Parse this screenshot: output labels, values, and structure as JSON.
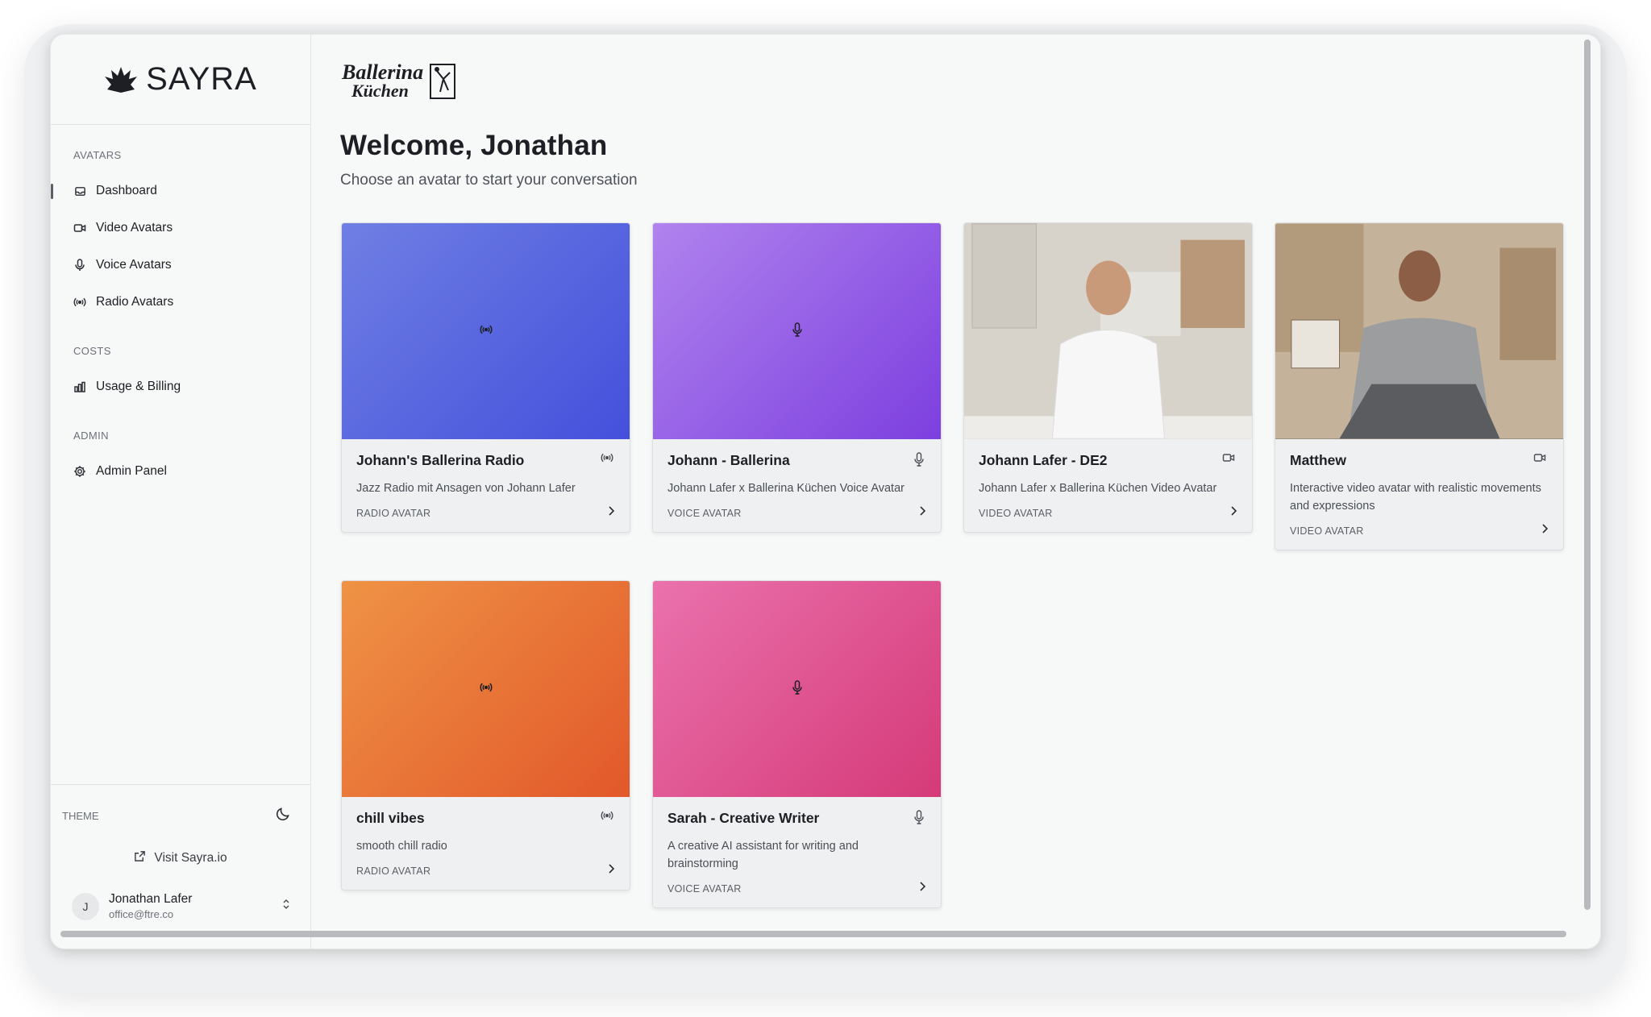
{
  "brand": {
    "name": "SAYRA"
  },
  "sidebar": {
    "sections": [
      {
        "label": "AVATARS",
        "items": [
          {
            "label": "Dashboard",
            "icon": "inbox-icon",
            "active": true
          },
          {
            "label": "Video Avatars",
            "icon": "video-icon"
          },
          {
            "label": "Voice Avatars",
            "icon": "microphone-icon"
          },
          {
            "label": "Radio Avatars",
            "icon": "radio-icon"
          }
        ]
      },
      {
        "label": "COSTS",
        "items": [
          {
            "label": "Usage & Billing",
            "icon": "bar-chart-icon"
          }
        ]
      },
      {
        "label": "ADMIN",
        "items": [
          {
            "label": "Admin Panel",
            "icon": "gear-icon"
          }
        ]
      }
    ],
    "theme_label": "THEME",
    "theme_icon": "moon-icon",
    "visit_label": "Visit Sayra.io",
    "user": {
      "initial": "J",
      "name": "Jonathan Lafer",
      "email": "office@ftre.co"
    }
  },
  "main": {
    "client_logo": {
      "line1": "Ballerina",
      "line2": "Küchen"
    },
    "welcome": "Welcome, Jonathan",
    "subtitle": "Choose an avatar to start your conversation",
    "cards": [
      {
        "title": "Johann's Ballerina Radio",
        "desc": "Jazz Radio mit Ansagen von Johann Lafer",
        "kind": "RADIO AVATAR",
        "icon": "radio-icon",
        "media": "gradient-blue"
      },
      {
        "title": "Johann - Ballerina",
        "desc": "Johann Lafer x Ballerina Küchen Voice Avatar",
        "kind": "VOICE AVATAR",
        "icon": "microphone-icon",
        "media": "gradient-purple"
      },
      {
        "title": "Johann Lafer - DE2",
        "desc": "Johann Lafer x Ballerina Küchen Video Avatar",
        "kind": "VIDEO AVATAR",
        "icon": "video-icon",
        "media": "photo-chef-kitchen"
      },
      {
        "title": "Matthew",
        "desc": "Interactive video avatar with realistic movements and expressions",
        "kind": "VIDEO AVATAR",
        "icon": "video-icon",
        "media": "photo-man-laptop"
      },
      {
        "title": "chill vibes",
        "desc": "smooth chill radio",
        "kind": "RADIO AVATAR",
        "icon": "radio-icon",
        "media": "gradient-orange"
      },
      {
        "title": "Sarah - Creative Writer",
        "desc": "A creative AI assistant for writing and brainstorming",
        "kind": "VOICE AVATAR",
        "icon": "microphone-icon",
        "media": "gradient-pink"
      }
    ]
  }
}
